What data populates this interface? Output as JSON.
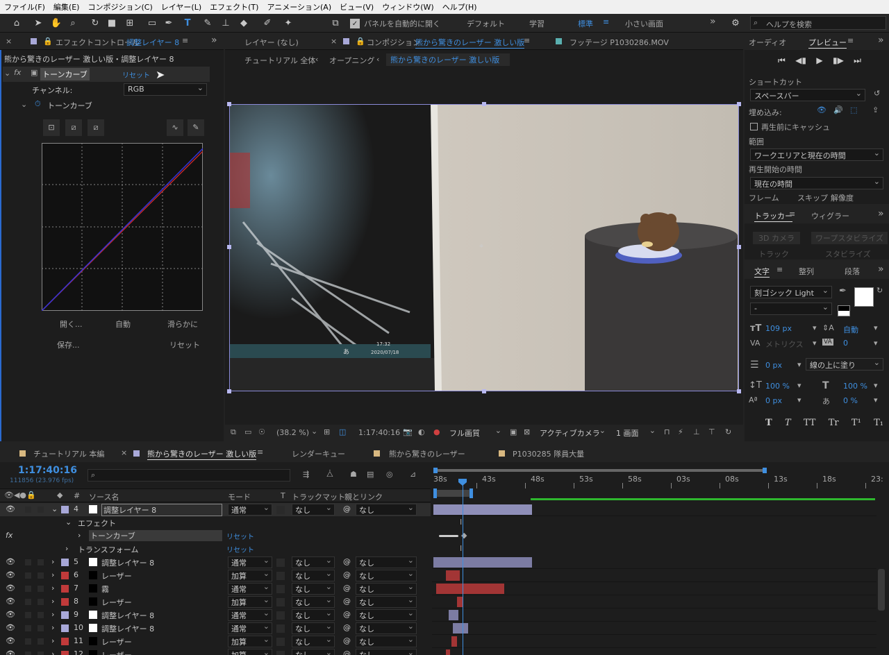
{
  "menu": [
    "ファイル(F)",
    "編集(E)",
    "コンポジション(C)",
    "レイヤー(L)",
    "エフェクト(T)",
    "アニメーション(A)",
    "ビュー(V)",
    "ウィンドウ(W)",
    "ヘルプ(H)"
  ],
  "toolbar": {
    "auto_open": "パネルを自動的に開く",
    "workspaces": [
      "デフォルト",
      "学習",
      "標準",
      "小さい画面"
    ],
    "search_placeholder": "ヘルプを検索"
  },
  "effects_panel": {
    "tab_prefix": "エフェクトコントロール",
    "tab_layer": "調整レイヤー 8",
    "breadcrumb": "熊から驚きのレーザー 激しい版・調整レイヤー 8",
    "effect_name": "トーンカーブ",
    "reset": "リセット",
    "channel_label": "チャンネル:",
    "channel_value": "RGB",
    "curve_prop": "トーンカーブ",
    "buttons": [
      "開く...",
      "自動",
      "滑らかに",
      "保存...",
      "リセット"
    ]
  },
  "comp_panel": {
    "layer_tab": "レイヤー (なし)",
    "comp_tab_prefix": "コンポジション",
    "comp_tab_name": "熊から驚きのレーザー 激しい版",
    "footage_tab": "フッテージ P1030286.MOV",
    "crumbs": [
      "チュートリアル 全体",
      "オープニング",
      "熊から驚きのレーザー 激しい版"
    ],
    "zoom": "(38.2 %)",
    "timecode": "1:17:40:16",
    "quality": "フル画質",
    "camera": "アクティブカメラ",
    "views": "1 画面",
    "screen_time": "17:32",
    "screen_date": "2020/07/18",
    "screen_ime": "あ"
  },
  "right": {
    "tabs1": [
      "オーディオ",
      "プレビュー"
    ],
    "shortcut_label": "ショートカット",
    "shortcut_value": "スペースバー",
    "embed_label": "埋め込み:",
    "cache_label": "再生前にキャッシュ",
    "range_label": "範囲",
    "range_value": "ワークエリアと現在の時間",
    "start_label": "再生開始の時間",
    "start_value": "現在の時間",
    "frame_row": [
      "フレーム",
      "スキップ",
      "解像度"
    ],
    "tabs2": [
      "トラッカー",
      "ウィグラー"
    ],
    "tracker_btns": [
      "3D カメラ",
      "ワープスタビライズ",
      "トラック",
      "スタビライズ"
    ],
    "tabs3": [
      "文字",
      "整列",
      "段落"
    ],
    "font": "刻ゴシック Light",
    "font_style": "-",
    "size": "109 px",
    "leading": "自動",
    "kerning": "メトリクス",
    "tracking": "0",
    "stroke": "0 px",
    "stroke_mode": "線の上に塗り",
    "vscale": "100 %",
    "hscale": "100 %",
    "baseline": "0 px",
    "tsume": "0 %",
    "text_styles": [
      "T",
      "T",
      "TT",
      "Tr",
      "T¹",
      "T₁"
    ]
  },
  "timeline": {
    "tabs": [
      "チュートリアル 本編",
      "熊から驚きのレーザー 激しい版",
      "レンダーキュー",
      "熊から驚きのレーザー",
      "P1030285 隊員大量"
    ],
    "timecode": "1:17:40:16",
    "frames": "111856 (23.976 fps)",
    "ruler": [
      "38s",
      "43s",
      "48s",
      "53s",
      "58s",
      "03s",
      "08s",
      "13s",
      "18s",
      "23:"
    ],
    "headers": {
      "source": "ソース名",
      "mode": "モード",
      "t": "T",
      "track": "トラックマット",
      "parent": "親とリンク"
    },
    "layers": [
      {
        "num": "4",
        "name": "調整レイヤー 8",
        "mode": "通常",
        "track": "なし",
        "parent": "なし",
        "label": "#a8a8d8",
        "sw": "#ffffff",
        "bar": "#8e8eb8"
      },
      {
        "num": "5",
        "name": "調整レイヤー 8",
        "mode": "通常",
        "track": "なし",
        "parent": "なし",
        "label": "#a8a8d8",
        "sw": "#ffffff",
        "bar": "#7c7ca3"
      },
      {
        "num": "6",
        "name": "レーザー",
        "mode": "加算",
        "track": "なし",
        "parent": "なし",
        "label": "#c03a3a",
        "sw": "#000000",
        "bar": "#a23535"
      },
      {
        "num": "7",
        "name": "霧",
        "mode": "通常",
        "track": "なし",
        "parent": "なし",
        "label": "#c03a3a",
        "sw": "#000000",
        "bar": "#a23535"
      },
      {
        "num": "8",
        "name": "レーザー",
        "mode": "加算",
        "track": "なし",
        "parent": "なし",
        "label": "#c03a3a",
        "sw": "#000000",
        "bar": "#a23535"
      },
      {
        "num": "9",
        "name": "調整レイヤー 8",
        "mode": "通常",
        "track": "なし",
        "parent": "なし",
        "label": "#a8a8d8",
        "sw": "#ffffff",
        "bar": "#7c7ca3"
      },
      {
        "num": "10",
        "name": "調整レイヤー 8",
        "mode": "通常",
        "track": "なし",
        "parent": "なし",
        "label": "#a8a8d8",
        "sw": "#ffffff",
        "bar": "#7c7ca3"
      },
      {
        "num": "11",
        "name": "レーザー",
        "mode": "加算",
        "track": "なし",
        "parent": "なし",
        "label": "#c03a3a",
        "sw": "#000000",
        "bar": "#a23535"
      },
      {
        "num": "12",
        "name": "レーザー",
        "mode": "加算",
        "track": "なし",
        "parent": "なし",
        "label": "#c03a3a",
        "sw": "#000000",
        "bar": "#a23535"
      }
    ],
    "sub": {
      "effects": "エフェクト",
      "curve": "トーンカーブ",
      "reset": "リセット",
      "transform": "トランスフォーム",
      "reset2": "リセット"
    }
  }
}
